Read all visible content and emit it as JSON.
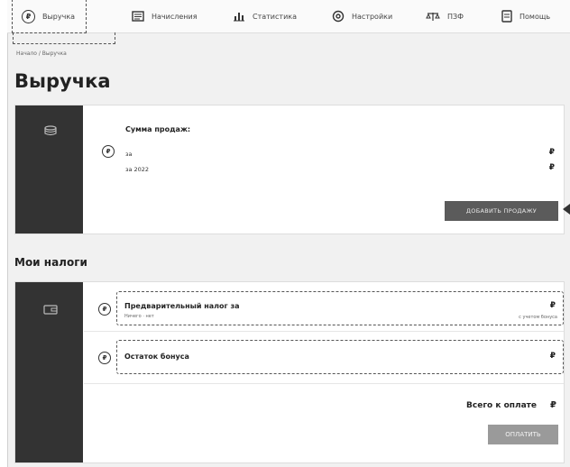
{
  "nav": {
    "items": [
      {
        "label": "Выручка",
        "icon": "ruble-circle-icon",
        "active": true
      },
      {
        "label": "Начисления",
        "icon": "document-list-icon"
      },
      {
        "label": "Статистика",
        "icon": "bar-chart-icon"
      },
      {
        "label": "Настройки",
        "icon": "gear-icon"
      },
      {
        "label": "ПЗФ",
        "icon": "scales-icon"
      },
      {
        "label": "Помощь",
        "icon": "help-doc-icon"
      }
    ]
  },
  "breadcrumb": "Начало / Выручка",
  "page_title": "Выручка",
  "revenue": {
    "currency_symbol": "₽",
    "sum_title": "Сумма продаж:",
    "rows": [
      {
        "label": "за",
        "value": "₽"
      },
      {
        "label": "за 2022",
        "value": "₽"
      }
    ],
    "add_sale_label": "ДОБАВИТЬ ПРОДАЖУ"
  },
  "taxes": {
    "section_title": "Мои налоги",
    "currency_symbol": "₽",
    "prelim": {
      "name": "Предварительный налог за",
      "sub": "Ничего · нет",
      "right_sub": "с учетом бонуса",
      "value": "₽"
    },
    "bonus": {
      "name": "Остаток бонуса",
      "value": "₽"
    },
    "total_label": "Всего к оплате",
    "total_value": "₽",
    "pay_label": "ОПЛАТИТЬ"
  },
  "colors": {
    "side_panel": "#333333",
    "add_sale_button": "#5b5b5b",
    "pay_button": "#9a9a9a",
    "background": "#f1f1f1"
  }
}
